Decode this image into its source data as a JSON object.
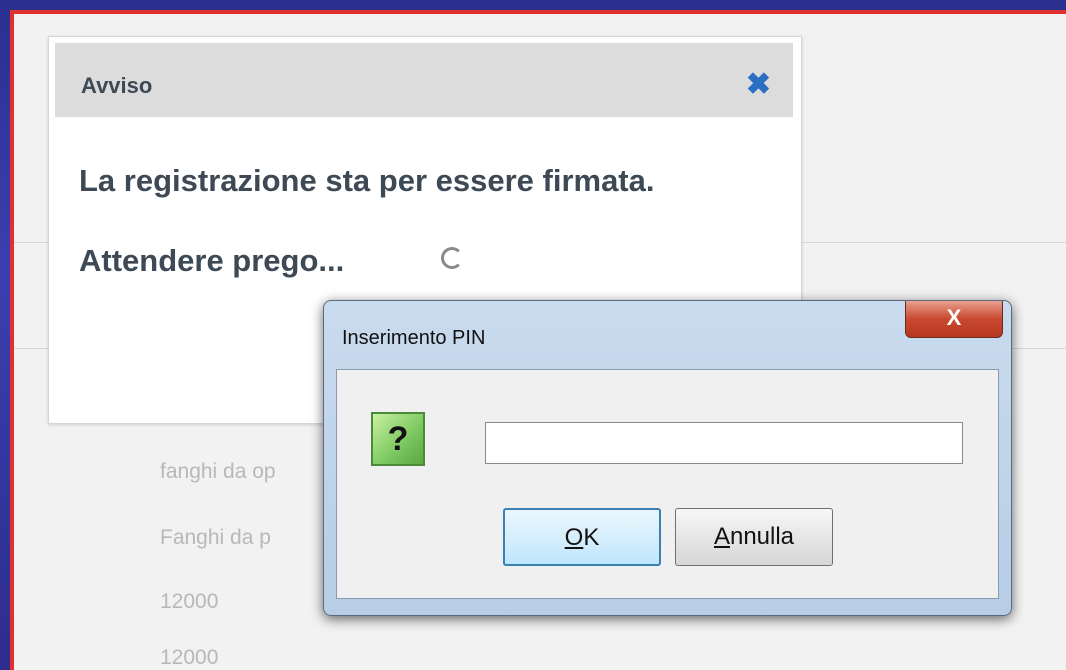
{
  "background_text": [
    "fanghi da op",
    "Fanghi da p",
    "12000",
    "12000"
  ],
  "avviso": {
    "title": "Avviso",
    "close_glyph": "✖",
    "message": "La registrazione sta per essere firmata.",
    "wait_text": "Attendere prego..."
  },
  "pin_dialog": {
    "title": "Inserimento PIN",
    "close_glyph": "X",
    "question_glyph": "?",
    "pin_value": "",
    "ok_mnemonic": "O",
    "ok_rest": "K",
    "cancel_mnemonic": "A",
    "cancel_rest": "nnulla"
  },
  "colors": {
    "frame_border": "#e03030",
    "close_icon": "#2a6fc2",
    "question_icon": "#7cc860"
  }
}
